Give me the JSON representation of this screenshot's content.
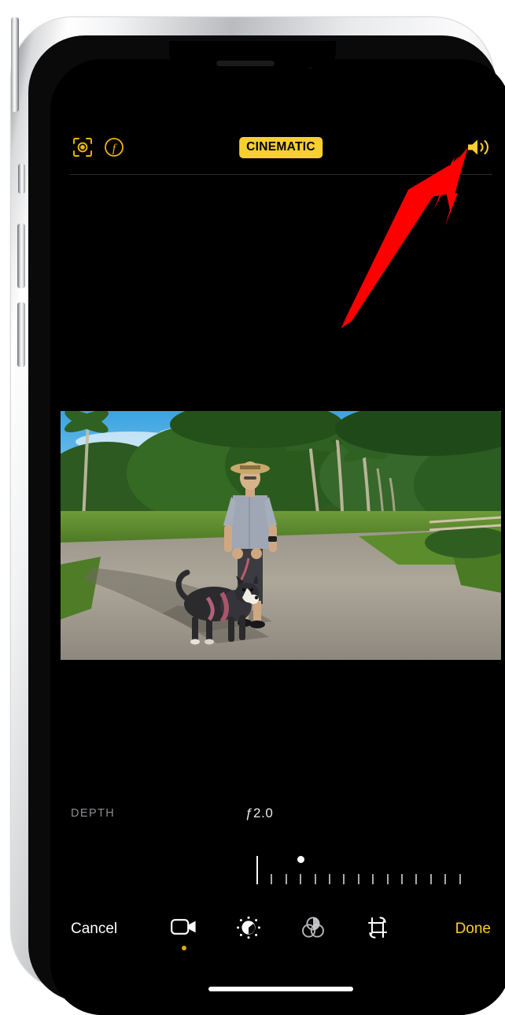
{
  "device": {
    "name": "iphone",
    "frame_color": "#d9dadc",
    "screen_background": "#000000"
  },
  "top_bar": {
    "focus_icon": "focus-subject-tracking-icon",
    "aperture_icon": "aperture-f-icon",
    "mode_badge": "CINEMATIC",
    "mode_badge_color": "#f7cf2e",
    "mode_badge_text_color": "#000000",
    "audio_icon": "speaker-on-icon",
    "audio_icon_color": "#f7cf2e"
  },
  "media": {
    "type": "video-frame",
    "description": "man in straw hat walking a dog on a paved driveway with palm trees"
  },
  "depth_control": {
    "label": "DEPTH",
    "value": "ƒ2.0",
    "label_color": "#8e8e93",
    "value_color": "#e9e9ea",
    "tick_count": 15,
    "major_tick_index": 0,
    "dot_tick_index": 3
  },
  "bottom_toolbar": {
    "cancel_label": "Cancel",
    "done_label": "Done",
    "done_color": "#f7cf2e",
    "tools": [
      {
        "name": "cinematic-video-icon",
        "active": true,
        "active_dot_color": "#e0a800"
      },
      {
        "name": "adjust-icon",
        "active": false
      },
      {
        "name": "filters-icon",
        "active": false
      },
      {
        "name": "crop-rotate-icon",
        "active": false
      }
    ]
  },
  "annotation": {
    "type": "arrow",
    "color": "#ff0000",
    "points_to": "speaker-on-icon"
  }
}
